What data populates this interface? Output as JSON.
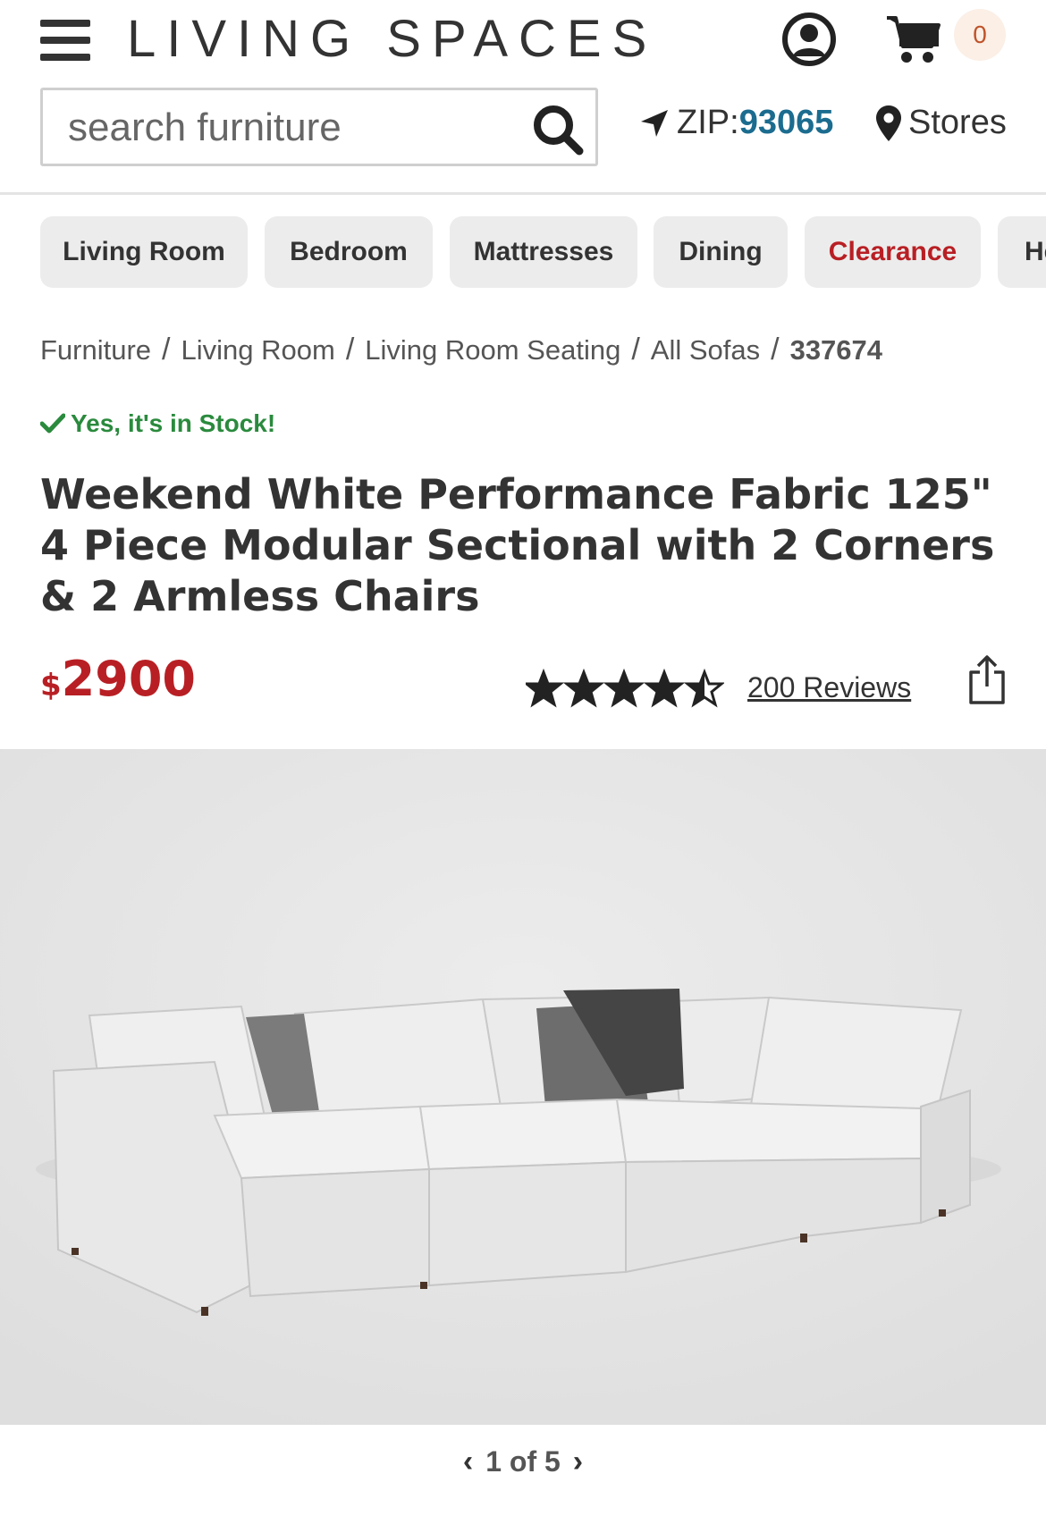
{
  "header": {
    "logo": "LIVING SPACES",
    "cart_count": "0",
    "search": {
      "placeholder": "search furniture",
      "value": ""
    },
    "zip_label": "ZIP: ",
    "zip_value": "93065",
    "stores_label": "Stores"
  },
  "categories": [
    "Living Room",
    "Bedroom",
    "Mattresses",
    "Dining",
    "Clearance",
    "He"
  ],
  "breadcrumb": [
    "Furniture",
    "Living Room",
    "Living Room Seating",
    "All Sofas",
    "337674"
  ],
  "product": {
    "stock_text": "Yes, it's in Stock!",
    "title": "Weekend White Performance Fabric 125\" 4 Piece Modular Sectional with 2 Corners & 2 Armless Chairs",
    "price_currency": "$",
    "price_amount": "2900",
    "rating": 4.5,
    "reviews_label": "200 Reviews"
  },
  "carousel": {
    "position": "1 of 5"
  },
  "colors": {
    "brand_red": "#b81f24",
    "zip_blue": "#1b6c8f",
    "stock_green": "#2a8a3d",
    "pill_bg": "#ececec"
  },
  "icons": [
    "hamburger-icon",
    "account-icon",
    "cart-icon",
    "search-icon",
    "location-arrow-icon",
    "map-pin-icon",
    "check-icon",
    "star-icon",
    "half-star-icon",
    "share-icon",
    "chevron-left-icon",
    "chevron-right-icon"
  ]
}
